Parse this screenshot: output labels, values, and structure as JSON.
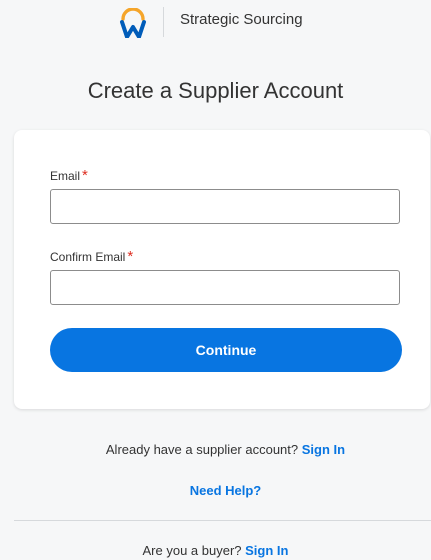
{
  "header": {
    "logo_icon": "workday-logo-icon",
    "title": "Strategic Sourcing"
  },
  "page": {
    "title": "Create a Supplier Account"
  },
  "form": {
    "email": {
      "label": "Email",
      "required_marker": "*",
      "value": ""
    },
    "confirm_email": {
      "label": "Confirm Email",
      "required_marker": "*",
      "value": ""
    },
    "continue_label": "Continue"
  },
  "footer": {
    "existing_account_text": "Already have a supplier account?",
    "existing_account_link": "Sign In",
    "help_link": "Need Help?",
    "buyer_text": "Are you a buyer?",
    "buyer_link": "Sign In"
  },
  "colors": {
    "accent": "#0875e1",
    "required": "#de2e21",
    "logo_orange": "#f5a52a",
    "logo_navy": "#005cb9"
  }
}
